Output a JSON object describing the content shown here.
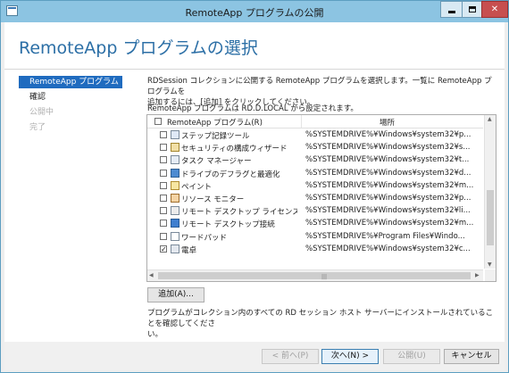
{
  "window": {
    "title": "RemoteApp プログラムの公開",
    "min_label": "",
    "max_label": "",
    "close_label": "✕"
  },
  "page": {
    "heading": "RemoteApp プログラムの選択"
  },
  "nav": {
    "items": [
      {
        "label": "RemoteApp プログラム",
        "state": "current"
      },
      {
        "label": "確認",
        "state": "enabled"
      },
      {
        "label": "公開中",
        "state": "disabled"
      },
      {
        "label": "完了",
        "state": "disabled"
      }
    ]
  },
  "description": {
    "line1": "RDSession コレクションに公開する RemoteApp プログラムを選択します。一覧に RemoteApp プログラムを",
    "line2": "追加するには、[追加] をクリックしてください。"
  },
  "subtitle": "RemoteApp プログラムは RD.D.LOCAL から設定されます。",
  "list": {
    "header_name": "RemoteApp プログラム(R)",
    "header_location": "場所",
    "header_checked": false,
    "rows": [
      {
        "name": "ステップ記録ツール",
        "location": "%SYSTEMDRIVE%¥Windows¥system32¥p...",
        "checked": false,
        "icon": "steps-recorder-icon"
      },
      {
        "name": "セキュリティの構成ウィザード",
        "location": "%SYSTEMDRIVE%¥Windows¥system32¥s...",
        "checked": false,
        "icon": "security-wizard-icon"
      },
      {
        "name": "タスク マネージャー",
        "location": "%SYSTEMDRIVE%¥Windows¥system32¥t...",
        "checked": false,
        "icon": "task-manager-icon"
      },
      {
        "name": "ドライブのデフラグと最適化",
        "location": "%SYSTEMDRIVE%¥Windows¥system32¥d...",
        "checked": false,
        "icon": "defrag-icon"
      },
      {
        "name": "ペイント",
        "location": "%SYSTEMDRIVE%¥Windows¥system32¥m...",
        "checked": false,
        "icon": "paint-icon"
      },
      {
        "name": "リソース モニター",
        "location": "%SYSTEMDRIVE%¥Windows¥system32¥p...",
        "checked": false,
        "icon": "resource-monitor-icon"
      },
      {
        "name": "リモート デスクトップ ライセンス マネージャー",
        "location": "%SYSTEMDRIVE%¥Windows¥system32¥li...",
        "checked": false,
        "icon": "license-manager-icon"
      },
      {
        "name": "リモート デスクトップ接続",
        "location": "%SYSTEMDRIVE%¥Windows¥system32¥m...",
        "checked": false,
        "icon": "remote-desktop-icon"
      },
      {
        "name": "ワードパッド",
        "location": "%SYSTEMDRIVE%¥Program Files¥Windo...",
        "checked": false,
        "icon": "wordpad-icon"
      },
      {
        "name": "電卓",
        "location": "%SYSTEMDRIVE%¥Windows¥system32¥c...",
        "checked": true,
        "icon": "calculator-icon"
      }
    ]
  },
  "add_button": "追加(A)...",
  "note": {
    "line1": "プログラムがコレクション内のすべての RD セッション ホスト サーバーにインストールされていることを確認してくださ",
    "line2": "い。"
  },
  "footer": {
    "back": "< 前へ(P)",
    "next": "次へ(N) >",
    "publish": "公開(U)",
    "cancel": "キャンセル"
  }
}
